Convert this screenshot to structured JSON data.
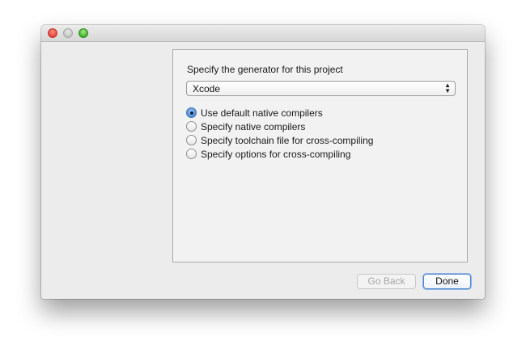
{
  "window": {
    "controls": [
      "close",
      "minimize",
      "zoom"
    ]
  },
  "generator": {
    "prompt": "Specify the generator for this project",
    "selected": "Xcode"
  },
  "compiler_options": [
    {
      "label": "Use default native compilers",
      "checked": true
    },
    {
      "label": "Specify native compilers",
      "checked": false
    },
    {
      "label": "Specify toolchain file for cross-compiling",
      "checked": false
    },
    {
      "label": "Specify options for cross-compiling",
      "checked": false
    }
  ],
  "buttons": {
    "back_label": "Go Back",
    "back_enabled": false,
    "done_label": "Done"
  },
  "colors": {
    "accent": "#4a87d6",
    "close": "#e0443a",
    "zoom": "#3fae2a"
  }
}
